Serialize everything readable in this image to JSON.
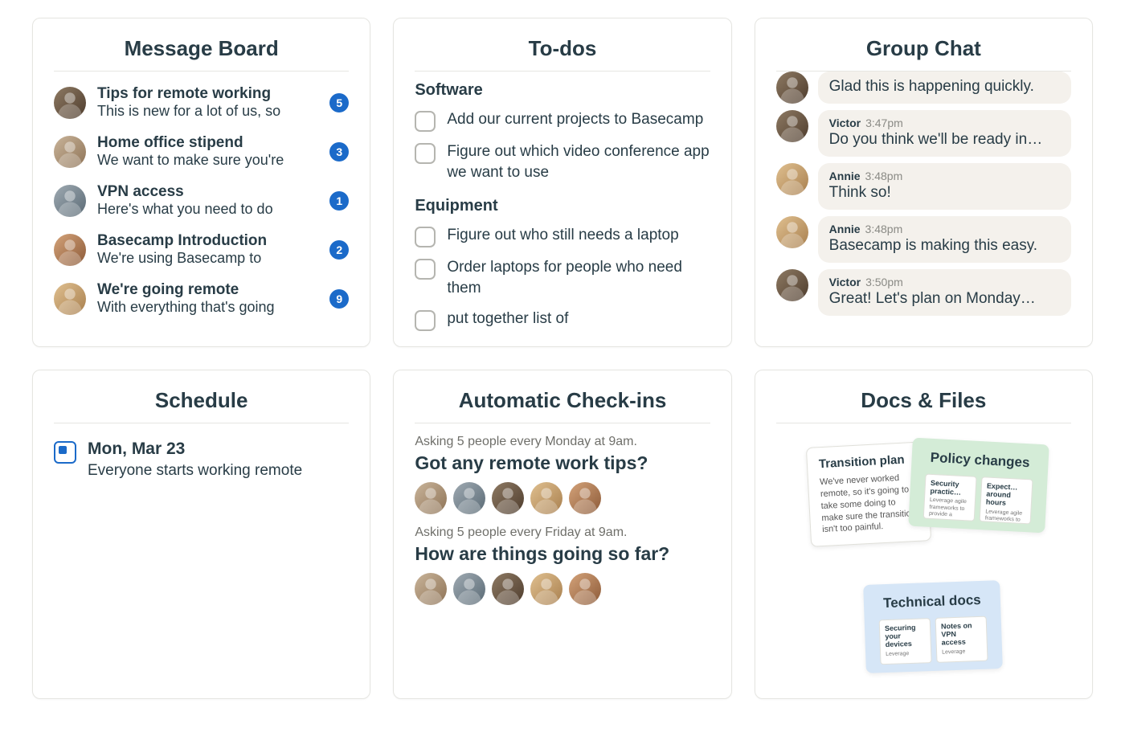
{
  "cards": {
    "messageBoard": {
      "title": "Message Board",
      "items": [
        {
          "title": "Tips for remote working",
          "preview": "This is new for a lot of us, so",
          "count": "5"
        },
        {
          "title": "Home office stipend",
          "preview": "We want to make sure you're",
          "count": "3"
        },
        {
          "title": "VPN access",
          "preview": "Here's what you need to do",
          "count": "1"
        },
        {
          "title": "Basecamp Introduction",
          "preview": "We're using Basecamp to",
          "count": "2"
        },
        {
          "title": "We're going remote",
          "preview": "With everything that's going",
          "count": "9"
        }
      ]
    },
    "todos": {
      "title": "To-dos",
      "sections": [
        {
          "name": "Software",
          "items": [
            "Add our current projects to Basecamp",
            "Figure out which video conference app we want to use"
          ]
        },
        {
          "name": "Equipment",
          "items": [
            "Figure out who still needs a laptop",
            "Order laptops for people who need them",
            "put together list of"
          ]
        }
      ]
    },
    "groupChat": {
      "title": "Group Chat",
      "messages": [
        {
          "name": "",
          "time": "",
          "text": "Glad this is happening quickly.",
          "top": true
        },
        {
          "name": "Victor",
          "time": "3:47pm",
          "text": "Do you think we'll be ready in…"
        },
        {
          "name": "Annie",
          "time": "3:48pm",
          "text": "Think so!"
        },
        {
          "name": "Annie",
          "time": "3:48pm",
          "text": "Basecamp is making this easy."
        },
        {
          "name": "Victor",
          "time": "3:50pm",
          "text": "Great! Let's plan on Monday…"
        }
      ]
    },
    "schedule": {
      "title": "Schedule",
      "date": "Mon, Mar 23",
      "desc": "Everyone starts working remote"
    },
    "checkins": {
      "title": "Automatic Check-ins",
      "blocks": [
        {
          "meta": "Asking 5 people every Monday at 9am.",
          "question": "Got any remote work tips?"
        },
        {
          "meta": "Asking 5 people every Friday at 9am.",
          "question": "How are things going so far?"
        }
      ]
    },
    "docs": {
      "title": "Docs & Files",
      "transition": {
        "title": "Transition plan",
        "body": "We've never worked remote, so it's going to take some doing to make sure the transition isn't too painful."
      },
      "policy": {
        "title": "Policy changes",
        "mini": [
          {
            "t": "Security practic…",
            "s": "Leverage agile frameworks to provide a"
          },
          {
            "t": "Expect… around hours",
            "s": "Leverage agile frameworks to provide a"
          }
        ]
      },
      "technical": {
        "title": "Technical docs",
        "mini": [
          {
            "t": "Securing your devices",
            "s": "Leverage"
          },
          {
            "t": "Notes on VPN access",
            "s": "Leverage"
          }
        ]
      }
    }
  }
}
